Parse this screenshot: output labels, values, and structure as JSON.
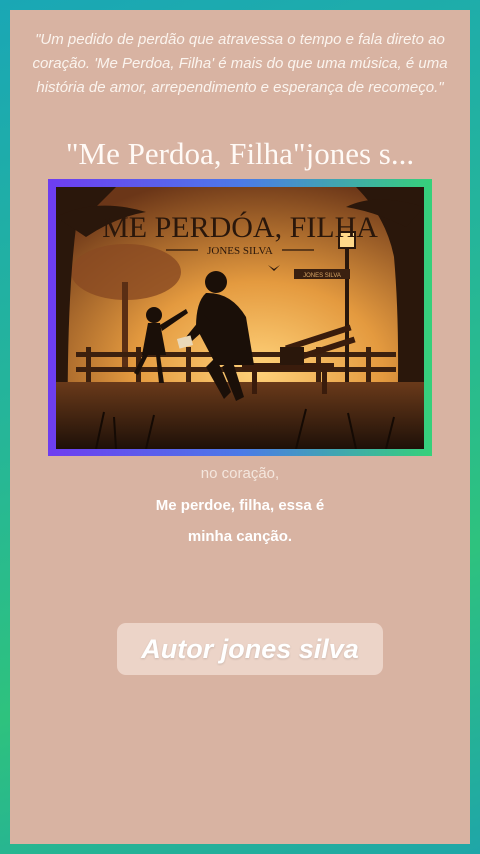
{
  "quote": "\"Um pedido de perdão que atravessa o tempo e fala direto ao coração. 'Me Perdoa, Filha' é mais do que uma música, é uma história de amor, arrependimento e esperança de recomeço.\"",
  "title": "\"Me Perdoa, Filha\"jones s...",
  "cover": {
    "title": "ME PERDÓA, FILHA",
    "artist": "JONES SILVA",
    "sign": "JONES SILVA"
  },
  "lyrics": {
    "line1": "no coração,",
    "line2": "Me perdoe, filha, essa é",
    "line3": "minha canção."
  },
  "author_button": "Autor jones silva",
  "colors": {
    "background_gradient": [
      "#1aa7b5",
      "#2ec27e"
    ],
    "panel": "#d8b3a2",
    "cover_border": [
      "#6e3df0",
      "#36d17a"
    ]
  }
}
